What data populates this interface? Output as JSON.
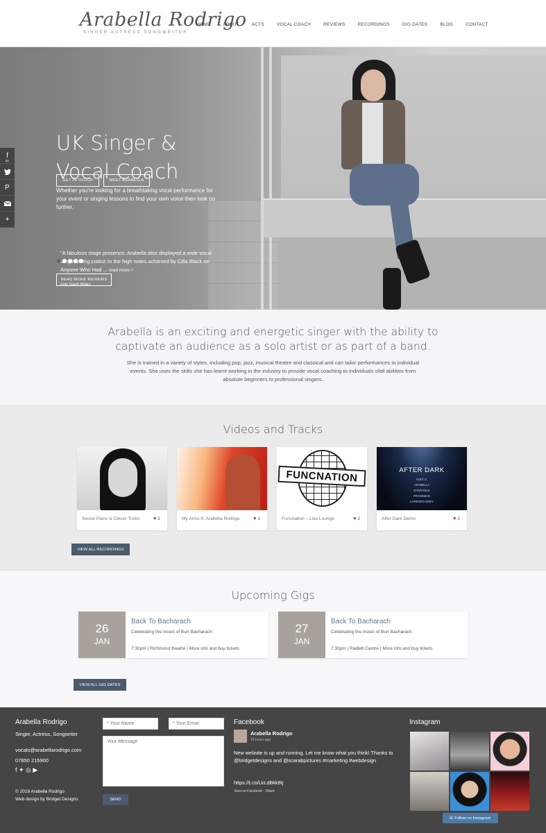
{
  "header": {
    "logo_name": "Arabella Rodrigo",
    "logo_tagline": "SINGER ACTRESS SONGWRITER",
    "nav": [
      "HOME",
      "ABOUT",
      "ACTS",
      "VOCAL COACH",
      "REVIEWS",
      "RECORDINGS",
      "GIG DATES",
      "BLOG",
      "CONTACT"
    ]
  },
  "social": {
    "facebook_icon": "f",
    "facebook_count": "61",
    "twitter_icon": "twitter-bird",
    "pinterest_icon": "P",
    "email_icon": "envelope",
    "more_icon": "+"
  },
  "hero": {
    "title_line1": "UK Singer &",
    "title_line2": "Vocal Coach",
    "text": "Whether you're looking for a breathtaking vocal performance for your event or singing lessons to find your own voice then look no further.",
    "btn_contact": "GET IN TOUCH",
    "btn_meet": "MEET ARABELLA",
    "quote": "\"A fabulous stage presence, Arabella also displayed a wide vocal range, doing justice to the high notes achieved by Cilla Black on Anyone Who Had ...",
    "quote_more": "read more >",
    "quote_source": "Ents South Wales",
    "btn_reviews": "READ MORE REVIEWS"
  },
  "intro": {
    "lead": "Arabella is an exciting and energetic singer with the ability to captivate an audience as a solo artist or as part of a band.",
    "body": "She is trained in a variety of styles, including pop, jazz, musical theatre and classical and can tailor performances to individual events. She uses the skills she has learnt working in the industry to provide vocal coaching to individuals ofall abilities from absolute beginners to professional singers."
  },
  "videos": {
    "title": "Videos and Tracks",
    "cards": [
      {
        "title": "Secret Plans & Clever Tricks",
        "likes": "2"
      },
      {
        "title": "My Arms ft. Arabella Rodrigo",
        "likes": "2"
      },
      {
        "title": "Funcnation – Live Lounge",
        "likes": "2",
        "thumb_text": "FUNCNATION"
      },
      {
        "title": "After Dark Demo",
        "likes": "2",
        "thumb_title": "AFTER DARK",
        "thumb_names": [
          "ALEX C.",
          "ARABELLA",
          "DANNYELE",
          "FRANKMAN",
          "LORENZO GREY"
        ]
      }
    ],
    "button": "VIEW ALL RECORDINGS"
  },
  "gigs": {
    "title": "Upcoming Gigs",
    "items": [
      {
        "day": "26",
        "month": "JAN",
        "title": "Back To Bacharach",
        "desc": "Celebrating the music of Burt Bacharach",
        "time": "7:30pm",
        "venue": "Richmond theatre",
        "link": "More info and buy tickets"
      },
      {
        "day": "27",
        "month": "JAN",
        "title": "Back To Bacharach",
        "desc": "Celebrating the music of Burt Bacharach",
        "time": "7:30pm",
        "venue": "Radlett Centre",
        "link": "More info and buy tickets"
      }
    ],
    "button": "VIEW ALL GIG DATES"
  },
  "footer": {
    "name": "Arabella Rodrigo",
    "subtitle": "Singer, Actress, Songwriter",
    "email": "vocals@arabellarodrigo.com",
    "phone": "07850 215900",
    "social_icons": "f ✦ ◎ ▶",
    "copyright": "© 2018 Arabella Rodrigo",
    "credit": "Web design by Bridget Designs",
    "form": {
      "name_placeholder": "* Your Name",
      "email_placeholder": "* Your Email",
      "message_placeholder": "Your Message",
      "send": "SEND"
    },
    "facebook": {
      "title": "Facebook",
      "author": "Arabella Rodrigo",
      "time": "19 hours ago",
      "post": "New website is up and running. Let me know what you think! Thanks to @bridgetdesigns and @scarabpictures #marketing #webdesign",
      "link": "https://t.co/LkLdBkk8tj",
      "actions": "View on Facebook · Share"
    },
    "instagram": {
      "title": "Instagram",
      "button": "Follow on Instagram"
    }
  }
}
